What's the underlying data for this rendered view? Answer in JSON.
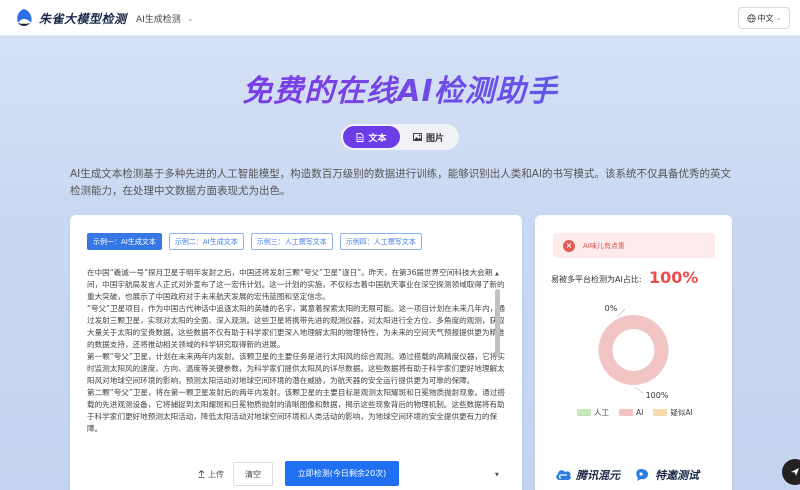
{
  "header": {
    "logo_text": "朱雀大模型检测",
    "nav_dropdown": "AI生成检测",
    "language": "中文"
  },
  "hero": {
    "title": "免费的在线AI检测助手",
    "tabs": [
      {
        "label": "文本",
        "active": true
      },
      {
        "label": "图片",
        "active": false
      }
    ],
    "description": "AI生成文本检测基于多种先进的人工智能模型，构造数百万级别的数据进行训练，能够识别出人类和AI的书写模式。该系统不仅具备优秀的英文检测能力，在处理中文数据方面表现尤为出色。"
  },
  "editor": {
    "samples": [
      {
        "label": "示例一：AI生成文本",
        "active": true
      },
      {
        "label": "示例二：AI生成文本",
        "active": false
      },
      {
        "label": "示例三：人工撰写文本",
        "active": false
      },
      {
        "label": "示例四：人工撰写文本",
        "active": false
      }
    ],
    "paragraphs": [
      "在中国“羲诚一号”探月卫星于明年发射之后，中国还将发射三颗“夸父”卫星“逐日”。昨天，在第36届世界空间科技大会期间，中国宇航局发言人正式对外宣布了这一宏伟计划。这一计划的实施，不仅标志着中国航天事业在深空探测领域取得了新的重大突破，也展示了中国政府对于未来航天发展的宏伟蓝图和坚定信念。",
      "“夸父”卫星项目，作为中国古代神话中追逐太阳的英雄的名字，寓意着探索太阳的无限可能。这一项目计划在未来几年内，通过发射三颗卫星，实现对太阳的全面、深入观测。这些卫星将携带先进的观测仪器，对太阳进行全方位、多角度的观测，获取大量关于太阳的宝贵数据。这些数据不仅有助于科学家们更深入地理解太阳的物理特性，为未来的空间天气预报提供更为精准的数据支持，还将推动相关领域的科学研究取得新的进展。",
      "第一颗“夸父”卫星，计划在未来两年内发射。该颗卫星的主要任务是进行太阳风的综合观测。通过搭载的高精度仪器，它将实时监测太阳风的速度、方向、温度等关键参数，为科学家们提供太阳风的详尽数据。这些数据将有助于科学家们更好地理解太阳风对地球空间环境的影响，预测太阳活动对地球空间环境的潜在威胁，为航天器的安全运行提供更为可靠的保障。",
      "第二颗“夸父”卫星，将在第一颗卫星发射后的两年内发射。该颗卫星的主要目标是观测太阳耀斑和日冕物质抛射现象。通过搭载的先进观测设备，它将捕捉到太阳耀斑和日冕物质抛射的清晰图像和数据，揭示这些现象背后的物理机制。这些数据将有助于科学家们更好地预测太阳活动，降低太阳活动对地球空间环境和人类活动的影响，为地球空间环境的安全提供更有力的保障。"
    ],
    "upload_label": "上传",
    "clear_label": "清空",
    "detect_label": "立即检测(今日剩余20次)"
  },
  "result": {
    "alert_text": "AI味儿有点重",
    "prob_label": "易被多平台检测为AI占比:",
    "prob_value": "100%",
    "donut_labels": {
      "top": "0%",
      "bottom": "100%"
    },
    "legend": [
      {
        "label": "人工",
        "color": "#c9e6b8"
      },
      {
        "label": "AI",
        "color": "#f2c4c4"
      },
      {
        "label": "疑似AI",
        "color": "#f5dcb0"
      }
    ],
    "brands": [
      "腾讯混元",
      "特邀测试"
    ]
  },
  "chart_data": {
    "type": "pie",
    "categories": [
      "人工",
      "AI",
      "疑似AI"
    ],
    "values": [
      0,
      100,
      0
    ],
    "colors": [
      "#c9e6b8",
      "#f2c4c4",
      "#f5dcb0"
    ],
    "title": "",
    "legend_position": "bottom"
  }
}
